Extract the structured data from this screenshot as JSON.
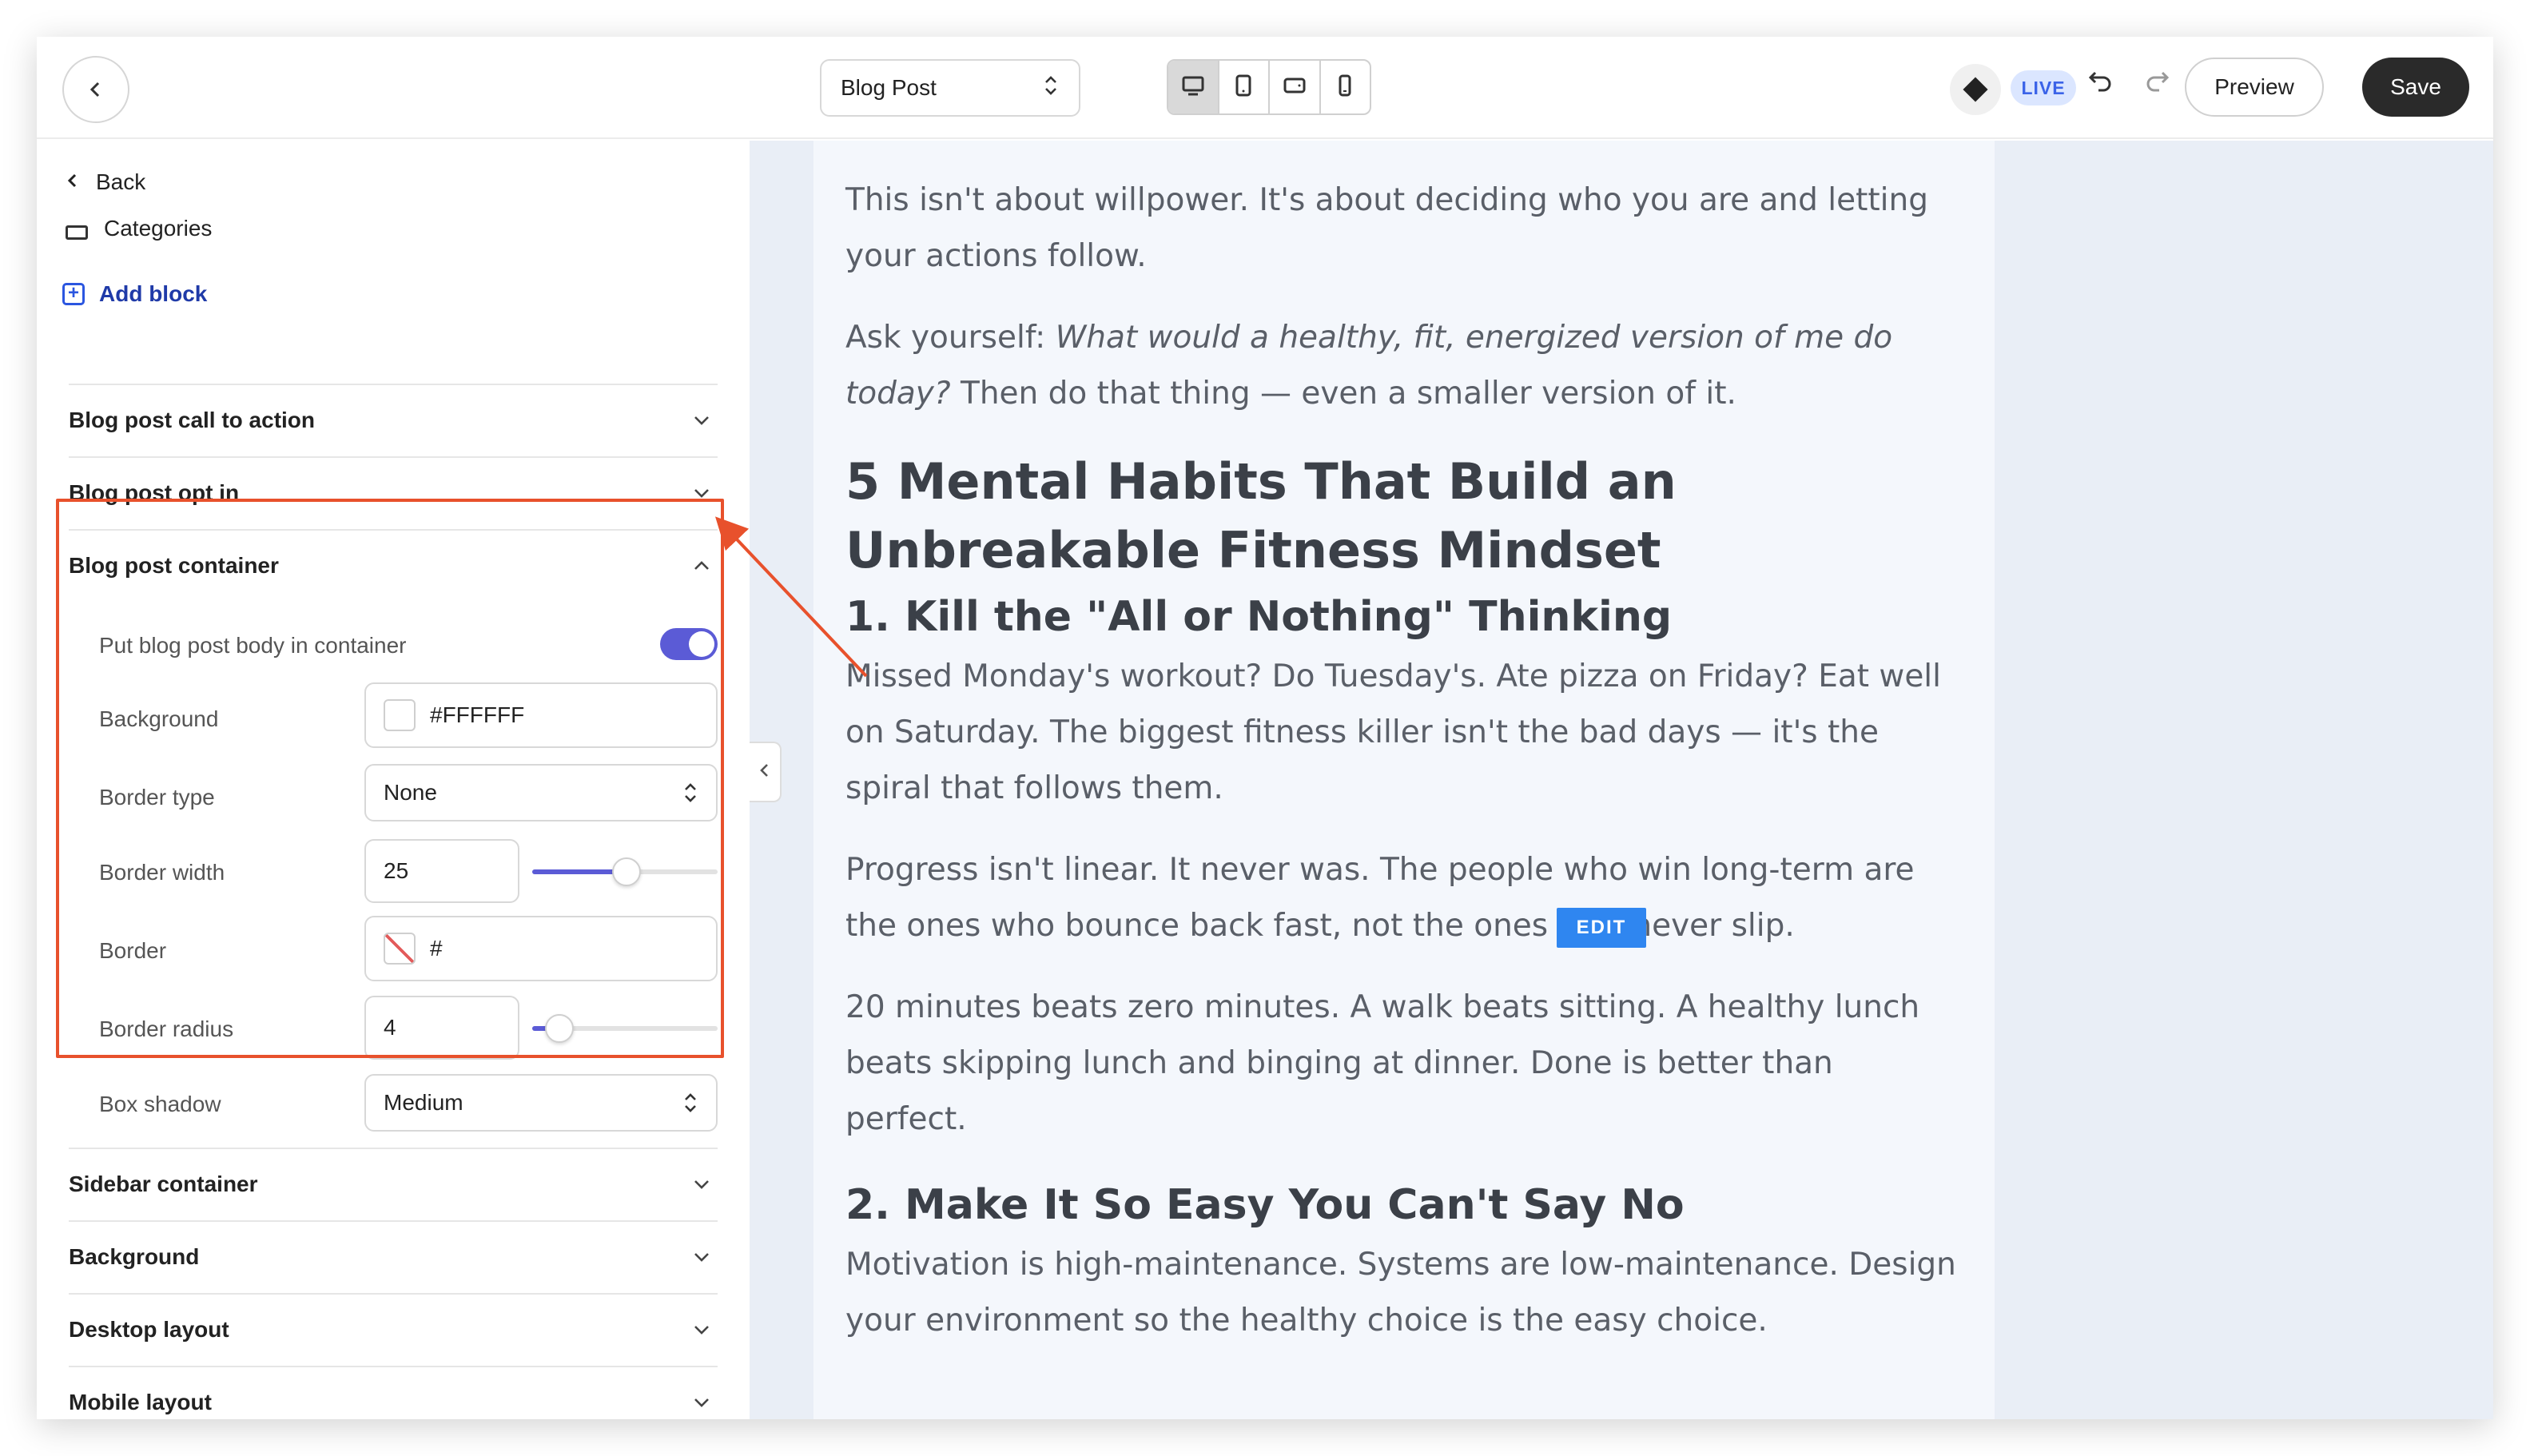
{
  "topbar": {
    "page_select": "Blog Post",
    "live_badge": "LIVE",
    "preview_label": "Preview",
    "save_label": "Save"
  },
  "sidebar": {
    "back_label": "Back",
    "categories_label": "Categories",
    "add_block_label": "Add block",
    "sections": {
      "cta": "Blog post call to action",
      "optin": "Blog post opt in",
      "container": "Blog post container",
      "sidebar_container": "Sidebar container",
      "background": "Background",
      "desktop_layout": "Desktop layout",
      "mobile_layout": "Mobile layout"
    },
    "container_panel": {
      "toggle_label": "Put blog post body in container",
      "toggle_on": true,
      "background_label": "Background",
      "background_value": "#FFFFFF",
      "border_type_label": "Border type",
      "border_type_value": "None",
      "border_width_label": "Border width",
      "border_width_value": "25",
      "border_label": "Border",
      "border_value": "#",
      "border_radius_label": "Border radius",
      "border_radius_value": "4",
      "box_shadow_label": "Box shadow",
      "box_shadow_value": "Medium"
    }
  },
  "article": {
    "p1": "This isn't about willpower. It's about deciding who you are and letting your actions follow.",
    "p2_start": "Ask yourself: ",
    "p2_italic": "What would a healthy, fit, energized version of me do today?",
    "p2_end": " Then do that thing — even a smaller version of it.",
    "h_main": "5 Mental Habits That Build an Unbreakable Fitness Mindset",
    "h1": "1. Kill the \"All or Nothing\" Thinking",
    "p3": "Missed Monday's workout? Do Tuesday's. Ate pizza on Friday? Eat well on Saturday. The biggest fitness killer isn't the bad days — it's the spiral that follows them.",
    "p4": "Progress isn't linear. It never was. The people who win long-term are the ones who bounce back fast, not the ones who never slip.",
    "p5": "20 minutes beats zero minutes. A walk beats sitting. A healthy lunch beats skipping lunch and binging at dinner. Done is better than perfect.",
    "h2": "2. Make It So Easy You Can't Say No",
    "p6": "Motivation is high-maintenance. Systems are low-maintenance. Design your environment so the healthy choice is the easy choice.",
    "edit_badge": "EDIT"
  },
  "colors": {
    "accent": "#5b5bd6",
    "highlight": "#e8512c",
    "link": "#1f3aa8",
    "edit_badge": "#2f86f0"
  }
}
